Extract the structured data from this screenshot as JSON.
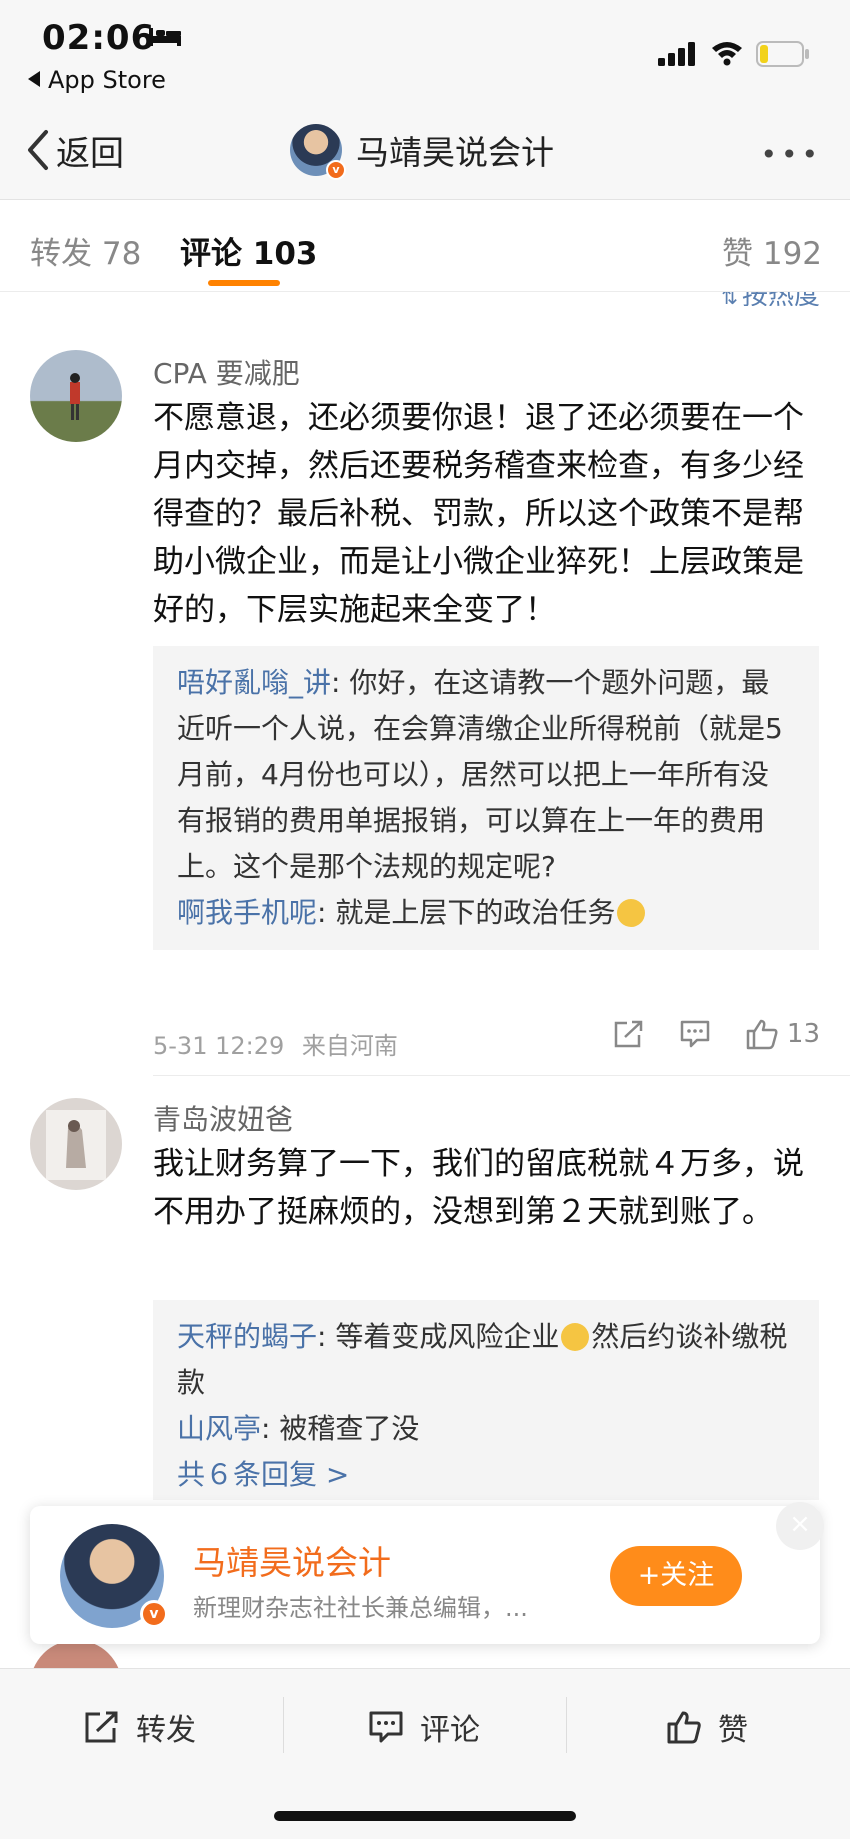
{
  "status_bar": {
    "time": "02:06",
    "back_app": "App Store",
    "icons": [
      "bed-icon",
      "signal-icon",
      "wifi-icon",
      "battery-icon"
    ]
  },
  "nav": {
    "back_label": "返回",
    "title": "马靖昊说会计",
    "more": "•••"
  },
  "tabs": {
    "repost": "转发 78",
    "comments": "评论 103",
    "likes": "赞 192"
  },
  "sort_label": "按热度",
  "comments": [
    {
      "user": "CPA 要减肥",
      "text": "不愿意退，还必须要你退！退了还必须要在一个月内交掉，然后还要税务稽查来检查，有多少经得查的？最后补税、罚款，所以这个政策不是帮助小微企业，而是让小微企业猝死！上层政策是好的，下层实施起来全变了！",
      "replies": [
        {
          "user": "唔好亂嗡_讲",
          "text": ": 你好，在这请教一个题外问题，最近听一个人说，在会算清缴企业所得税前（就是5月前，4月份也可以），居然可以把上一年所有没有报销的费用单据报销，可以算在上一年的费用上。这个是那个法规的规定呢?"
        },
        {
          "user": "啊我手机呢",
          "text": ": 就是上层下的政治任务"
        }
      ],
      "time": "5-31 12:29",
      "location": "来自河南",
      "like_count": "13"
    },
    {
      "user": "青岛波妞爸",
      "text": "我让财务算了一下，我们的留底税就４万多，说不用办了挺麻烦的，没想到第２天就到账了。",
      "replies": [
        {
          "user": "天秤的蝎子",
          "text": ": 等着变成风险企业",
          "text2": "然后约谈补缴税款"
        },
        {
          "user": "山风亭",
          "text": ": 被稽查了没"
        }
      ],
      "more_replies": "共６条回复 >"
    }
  ],
  "follow_card": {
    "name": "马靖昊说会计",
    "description": "新理财杂志社社长兼总编辑，...",
    "follow_label": "+关注",
    "close": "×",
    "badge": "v"
  },
  "bottom_bar": {
    "repost": "转发",
    "comment": "评论",
    "like": "赞"
  }
}
